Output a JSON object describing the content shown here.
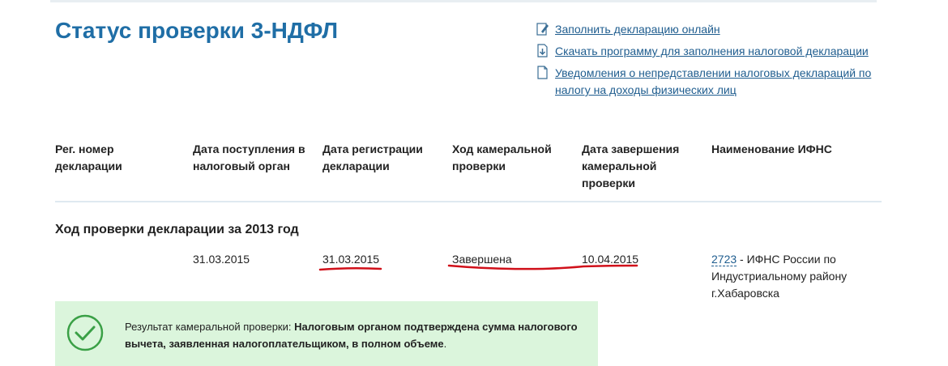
{
  "page": {
    "title": "Статус проверки 3-НДФЛ"
  },
  "links": [
    {
      "label": "Заполнить декларацию онлайн",
      "icon": "edit-document-icon"
    },
    {
      "label": "Скачать программу для заполнения налоговой декларации",
      "icon": "download-icon"
    },
    {
      "label": "Уведомления о непредставлении налоговых деклараций по налогу на доходы физических лиц",
      "icon": "document-icon"
    }
  ],
  "table": {
    "headers": [
      "Рег. номер декларации",
      "Дата поступления в налоговый орган",
      "Дата регистрации декларации",
      "Ход камеральной проверки",
      "Дата завершения камеральной проверки",
      "Наименование ИФНС"
    ],
    "section_title": "Ход проверки декларации за 2013 год",
    "row": {
      "reg_number": "",
      "received_date": "31.03.2015",
      "registration_date": "31.03.2015",
      "status": "Завершена",
      "completion_date": "10.04.2015",
      "ifns_code": "2723",
      "ifns_name": " - ИФНС России по Индустриальному району г.Хабаровска"
    }
  },
  "result": {
    "label": "Результат камеральной проверки: ",
    "text": "Налоговым органом подтверждена сумма налогового вычета, заявленная налогоплательщиком, в полном объеме",
    "suffix": "."
  },
  "colors": {
    "title": "#1f6ea6",
    "link": "#1f5d8f",
    "result_bg": "#dbf5dc",
    "check": "#3aa046",
    "annotation_red": "#d0101a"
  }
}
